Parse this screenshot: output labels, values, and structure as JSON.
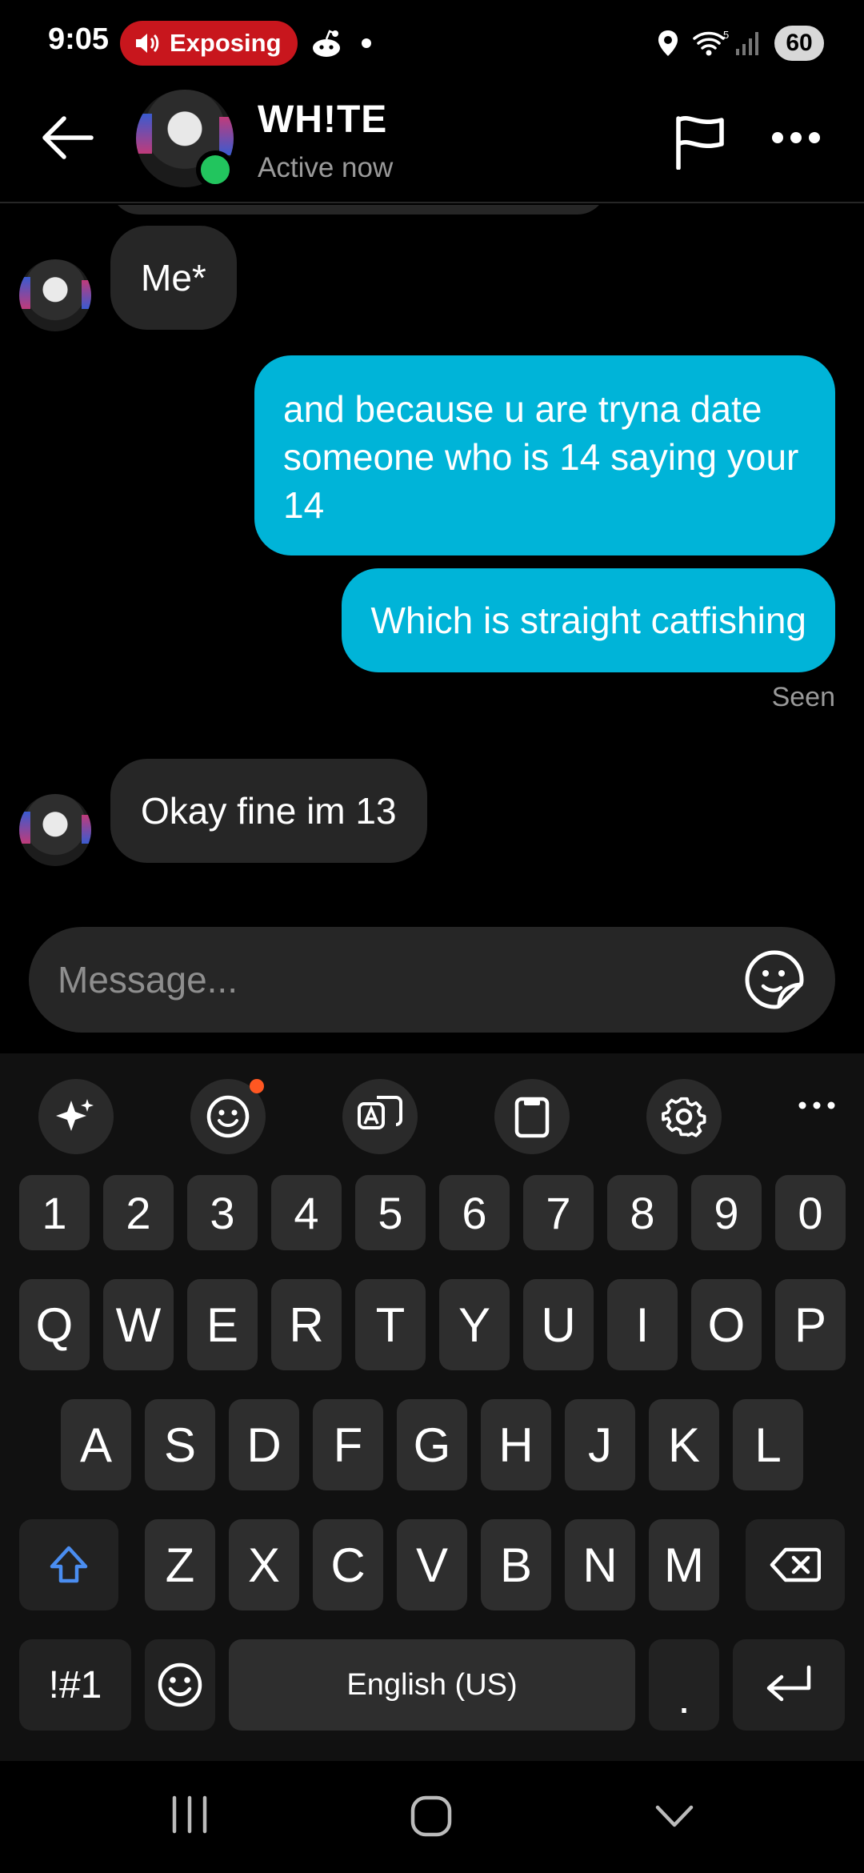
{
  "status_bar": {
    "time": "9:05",
    "recording_label": "Exposing",
    "battery": "60",
    "wifi_label": "5"
  },
  "header": {
    "name": "WH!TE",
    "status": "Active now"
  },
  "messages": [
    {
      "from": "them",
      "text": "Me*"
    },
    {
      "from": "me",
      "text": "and because u are tryna date someone who is 14 saying your 14"
    },
    {
      "from": "me",
      "text": "Which is straight catfishing"
    },
    {
      "from": "them",
      "text": "Okay fine im 13"
    }
  ],
  "seen_label": "Seen",
  "composer": {
    "placeholder": "Message..."
  },
  "keyboard": {
    "numbers": [
      "1",
      "2",
      "3",
      "4",
      "5",
      "6",
      "7",
      "8",
      "9",
      "0"
    ],
    "row1": [
      "Q",
      "W",
      "E",
      "R",
      "T",
      "Y",
      "U",
      "I",
      "O",
      "P"
    ],
    "row2": [
      "A",
      "S",
      "D",
      "F",
      "G",
      "H",
      "J",
      "K",
      "L"
    ],
    "row3": [
      "Z",
      "X",
      "C",
      "V",
      "B",
      "N",
      "M"
    ],
    "symbols_label": "!#1",
    "space_label": "English (US)",
    "period_label": "."
  },
  "colors": {
    "accent": "#00b4d8",
    "incoming_bubble": "#262626",
    "online": "#22c55e",
    "recording": "#c8161d"
  }
}
